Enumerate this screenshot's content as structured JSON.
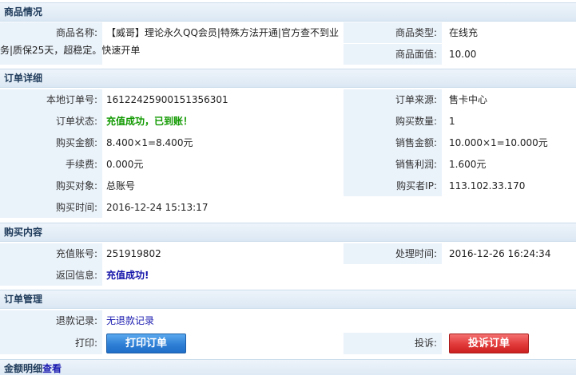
{
  "product_section": {
    "title": "商品情况",
    "name_label": "商品名称:",
    "name_line1": "【威哥】理论永久QQ会员|特殊方法开通|官方查不到业",
    "name_line2": "务|质保25天，超稳定。快速开单",
    "type_label": "商品类型:",
    "type_value": "在线充",
    "face_label": "商品面值:",
    "face_value": "10.00"
  },
  "order_section": {
    "title": "订单详细",
    "local_no_label": "本地订单号:",
    "local_no_value": "16122425900151356301",
    "source_label": "订单来源:",
    "source_value": "售卡中心",
    "status_label": "订单状态:",
    "status_value": "充值成功，已到账！",
    "quantity_label": "购买数量:",
    "quantity_value": "1",
    "amount_label": "购买金额:",
    "amount_value": "8.400×1=8.400元",
    "sales_amount_label": "销售金额:",
    "sales_amount_value": "10.000×1=10.000元",
    "fee_label": "手续费:",
    "fee_value": "0.000元",
    "profit_label": "销售利润:",
    "profit_value": "1.600元",
    "target_label": "购买对象:",
    "target_value": "总账号",
    "buyer_ip_label": "购买者IP:",
    "buyer_ip_value": "113.102.33.170",
    "time_label": "购买时间:",
    "time_value": "2016-12-24 15:13:17"
  },
  "purchase_section": {
    "title": "购买内容",
    "account_label": "充值账号:",
    "account_value": "251919802",
    "process_time_label": "处理时间:",
    "process_time_value": "2016-12-26 16:24:34",
    "return_label": "返回信息:",
    "return_value": "充值成功!"
  },
  "manage_section": {
    "title": "订单管理",
    "refund_label": "退款记录:",
    "refund_value": "无退款记录",
    "print_label": "打印:",
    "print_button": "打印订单",
    "complain_label": "投诉:",
    "complain_button": "投诉订单"
  },
  "detail_section": {
    "title": "金额明细",
    "link": "查看"
  }
}
